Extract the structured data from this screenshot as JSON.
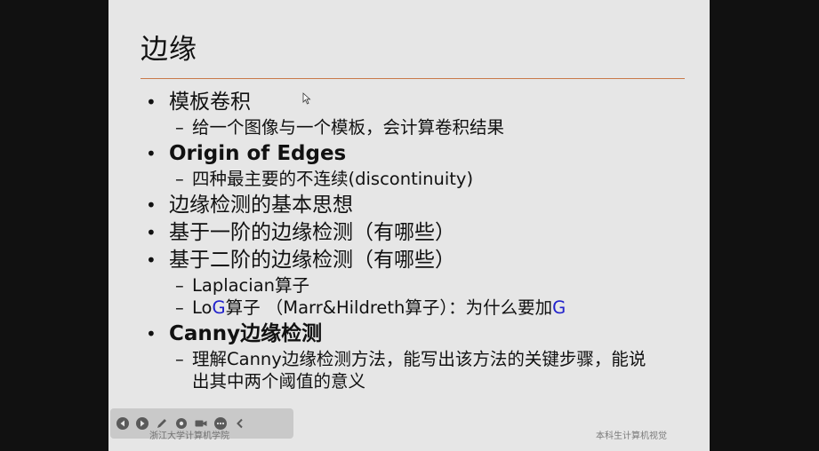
{
  "slide": {
    "title": "边缘",
    "items": [
      {
        "level": 1,
        "text": "模板卷积",
        "bold": false
      },
      {
        "level": 2,
        "text": "给一个图像与一个模板，会计算卷积结果"
      },
      {
        "level": 1,
        "text": "Origin of Edges",
        "bold": true
      },
      {
        "level": 2,
        "text": "四种最主要的不连续(discontinuity)"
      },
      {
        "level": 1,
        "text": "边缘检测的基本思想",
        "bold": false
      },
      {
        "level": 1,
        "text": "基于一阶的边缘检测（有哪些）",
        "bold": false
      },
      {
        "level": 1,
        "text": "基于二阶的边缘检测（有哪些）",
        "bold": false
      },
      {
        "level": 2,
        "text": "Laplacian算子"
      },
      {
        "level": 2,
        "parts": [
          "Lo",
          "G",
          "算子 （Marr&Hildreth算子）：为什么要加",
          "G"
        ]
      },
      {
        "level": 1,
        "text": "Canny边缘检测",
        "bold": true,
        "bold_part": "Canny",
        "rest": "边缘检测"
      },
      {
        "level": 2,
        "text": "理解Canny边缘检测方法，能写出该方法的关键步骤，能说出其中两个阈值的意义"
      }
    ],
    "bullet_symbol": "•",
    "dash_symbol": "–",
    "footer_left": "浙江大学计算机学院",
    "footer_right": "本科生计算机视觉"
  },
  "colors": {
    "accent_rule": "#c9794a",
    "highlight_blue": "#2222cc",
    "slide_bg": "#e6e6e6",
    "letterbox": "#111111"
  },
  "toolbar": {
    "icons": [
      "prev-icon",
      "next-icon",
      "pen-icon",
      "settings-icon",
      "camera-icon",
      "more-icon",
      "collapse-icon"
    ]
  }
}
